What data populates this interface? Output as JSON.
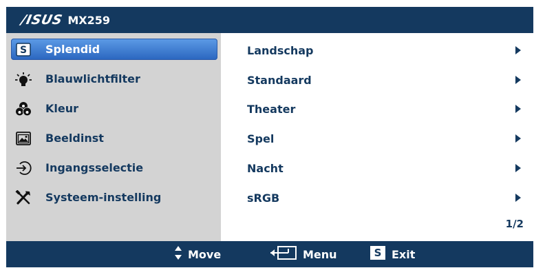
{
  "header": {
    "brand": "/ISUS",
    "model": "MX259"
  },
  "sidebar": {
    "items": [
      {
        "label": "Splendid",
        "icon": "splendid-s-icon",
        "active": true
      },
      {
        "label": "Blauwlichtfilter",
        "icon": "bulb-icon",
        "active": false
      },
      {
        "label": "Kleur",
        "icon": "rgb-circles-icon",
        "active": false
      },
      {
        "label": "Beeldinst",
        "icon": "picture-icon",
        "active": false
      },
      {
        "label": "Ingangsselectie",
        "icon": "input-arrow-icon",
        "active": false
      },
      {
        "label": "Systeem-instelling",
        "icon": "wrench-screwdriver-icon",
        "active": false
      }
    ]
  },
  "options": [
    {
      "label": "Landschap"
    },
    {
      "label": "Standaard"
    },
    {
      "label": "Theater"
    },
    {
      "label": "Spel"
    },
    {
      "label": "Nacht"
    },
    {
      "label": "sRGB"
    }
  ],
  "page_indicator": "1/2",
  "footer": {
    "move_label": "Move",
    "menu_label": "Menu",
    "exit_label": "Exit",
    "exit_icon_letter": "S"
  },
  "colors": {
    "navy": "#14395f",
    "sidebar": "#d3d3d3",
    "highlight": "#3f80d8"
  }
}
